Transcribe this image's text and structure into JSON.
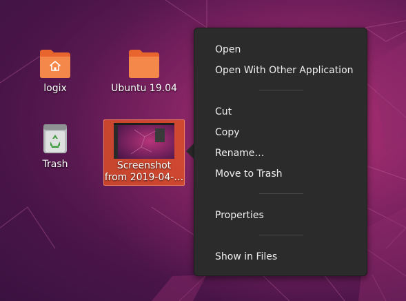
{
  "desktop": {
    "icons": [
      {
        "label": "logix",
        "icon": "home-folder-icon"
      },
      {
        "label": "Ubuntu 19.04",
        "icon": "folder-icon"
      },
      {
        "label": "Trash",
        "icon": "trash-icon"
      },
      {
        "label": "Screenshot from 2019-04-…",
        "label_line1": "Screenshot",
        "label_line2": "from 2019-04-…",
        "icon": "screenshot-thumbnail",
        "selected": true
      }
    ]
  },
  "context_menu": {
    "items": [
      {
        "label": "Open"
      },
      {
        "label": "Open With Other Application"
      },
      {
        "label": "Cut"
      },
      {
        "label": "Copy"
      },
      {
        "label": "Rename…"
      },
      {
        "label": "Move to Trash"
      },
      {
        "label": "Properties"
      },
      {
        "label": "Show in Files"
      }
    ]
  },
  "colors": {
    "folder": "#f07c3a",
    "selection": "#e95420",
    "menu_bg": "#2b2b2b",
    "menu_text": "#f0f0f0"
  }
}
